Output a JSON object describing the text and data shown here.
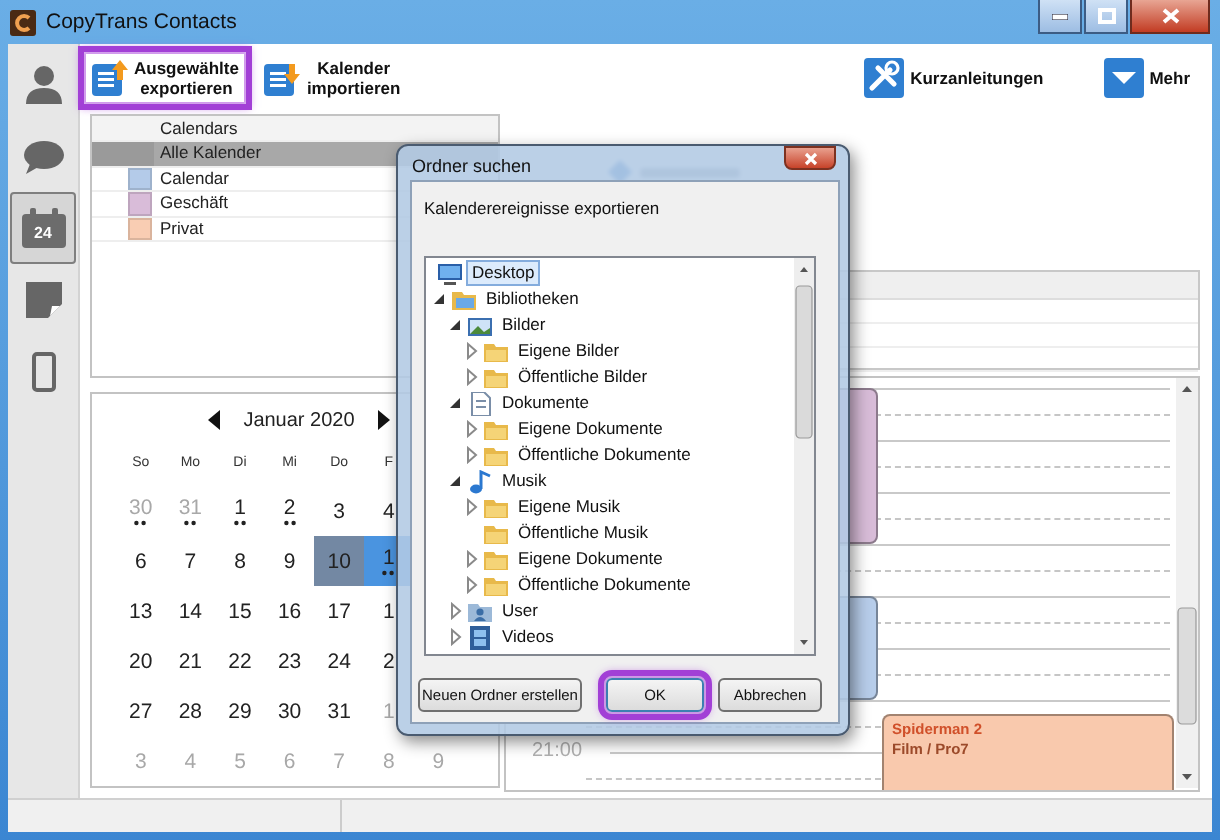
{
  "window": {
    "title": "CopyTrans Contacts"
  },
  "sidebar": {
    "items": [
      {
        "kind": "contacts",
        "selected": false
      },
      {
        "kind": "messages",
        "selected": false
      },
      {
        "kind": "calendar",
        "selected": true,
        "badge": "24"
      },
      {
        "kind": "notes",
        "selected": false
      },
      {
        "kind": "device",
        "selected": false
      }
    ]
  },
  "toolbar": {
    "buttons": [
      {
        "kind": "export",
        "lines": [
          "Ausgewählte",
          "exportieren"
        ],
        "highlighted": true
      },
      {
        "kind": "import",
        "lines": [
          "Kalender",
          "importieren"
        ],
        "highlighted": false
      }
    ],
    "right_buttons": [
      {
        "kind": "guides",
        "label": "Kurzanleitungen"
      },
      {
        "kind": "more",
        "label": "Mehr"
      }
    ]
  },
  "calendars": {
    "header": "Calendars",
    "rows": [
      {
        "name": "Alle Kalender",
        "selected": true
      },
      {
        "name": "Calendar",
        "color": "#b4cbe9",
        "selected": false
      },
      {
        "name": "Geschäft",
        "color": "#d9bcd9",
        "selected": false
      },
      {
        "name": "Privat",
        "color": "#f9cdb3",
        "selected": false
      }
    ]
  },
  "month": {
    "title": "Januar 2020",
    "weekdays": [
      "So",
      "Mo",
      "Di",
      "Mi",
      "Do",
      "F"
    ],
    "weeks": [
      [
        {
          "day": "30",
          "muted": true,
          "events": true,
          "selected": false,
          "today": false
        },
        {
          "day": "31",
          "muted": true,
          "events": true,
          "selected": false,
          "today": false
        },
        {
          "day": "1",
          "muted": false,
          "events": true,
          "selected": false,
          "today": false
        },
        {
          "day": "2",
          "muted": false,
          "events": true,
          "selected": false,
          "today": false
        },
        {
          "day": "3",
          "muted": false,
          "events": false,
          "selected": false,
          "today": false
        },
        {
          "day": "4",
          "muted": false,
          "events": false,
          "selected": false,
          "today": false
        }
      ],
      [
        {
          "day": "6",
          "muted": false,
          "events": false,
          "selected": false,
          "today": false
        },
        {
          "day": "7",
          "muted": false,
          "events": false,
          "selected": false,
          "today": false
        },
        {
          "day": "8",
          "muted": false,
          "events": false,
          "selected": false,
          "today": false
        },
        {
          "day": "9",
          "muted": false,
          "events": false,
          "selected": false,
          "today": false
        },
        {
          "day": "10",
          "muted": false,
          "events": false,
          "selected": true,
          "today": false
        },
        {
          "day": "1",
          "muted": false,
          "events": true,
          "selected": false,
          "today": true
        }
      ],
      [
        {
          "day": "13",
          "muted": false,
          "events": false,
          "selected": false,
          "today": false
        },
        {
          "day": "14",
          "muted": false,
          "events": false,
          "selected": false,
          "today": false
        },
        {
          "day": "15",
          "muted": false,
          "events": false,
          "selected": false,
          "today": false
        },
        {
          "day": "16",
          "muted": false,
          "events": false,
          "selected": false,
          "today": false
        },
        {
          "day": "17",
          "muted": false,
          "events": false,
          "selected": false,
          "today": false
        },
        {
          "day": "1",
          "muted": false,
          "events": false,
          "selected": false,
          "today": false
        }
      ],
      [
        {
          "day": "20",
          "muted": false,
          "events": false,
          "selected": false,
          "today": false
        },
        {
          "day": "21",
          "muted": false,
          "events": false,
          "selected": false,
          "today": false
        },
        {
          "day": "22",
          "muted": false,
          "events": false,
          "selected": false,
          "today": false
        },
        {
          "day": "23",
          "muted": false,
          "events": false,
          "selected": false,
          "today": false
        },
        {
          "day": "24",
          "muted": false,
          "events": false,
          "selected": false,
          "today": false
        },
        {
          "day": "2",
          "muted": false,
          "events": false,
          "selected": false,
          "today": false
        }
      ],
      [
        {
          "day": "27",
          "muted": false,
          "events": false,
          "selected": false,
          "today": false
        },
        {
          "day": "28",
          "muted": false,
          "events": false,
          "selected": false,
          "today": false
        },
        {
          "day": "29",
          "muted": false,
          "events": false,
          "selected": false,
          "today": false
        },
        {
          "day": "30",
          "muted": false,
          "events": false,
          "selected": false,
          "today": false
        },
        {
          "day": "31",
          "muted": false,
          "events": false,
          "selected": false,
          "today": false
        },
        {
          "day": "1",
          "muted": true,
          "events": false,
          "selected": false,
          "today": false
        }
      ],
      [
        {
          "day": "3",
          "muted": true,
          "events": false,
          "selected": false,
          "today": false
        },
        {
          "day": "4",
          "muted": true,
          "events": false,
          "selected": false,
          "today": false
        },
        {
          "day": "5",
          "muted": true,
          "events": false,
          "selected": false,
          "today": false
        },
        {
          "day": "6",
          "muted": true,
          "events": false,
          "selected": false,
          "today": false
        },
        {
          "day": "7",
          "muted": true,
          "events": false,
          "selected": false,
          "today": false
        },
        {
          "day": "8",
          "muted": true,
          "events": false,
          "selected": false,
          "today": false
        },
        {
          "day": "9",
          "muted": true,
          "events": false,
          "selected": false,
          "today": false
        }
      ]
    ]
  },
  "day_view": {
    "time_label": "21:00",
    "events": [
      {
        "color": "#d8bcd8"
      },
      {
        "color": "#b7cdea"
      },
      {
        "color": "#f9c9ad",
        "title": "Spiderman 2",
        "subtitle": "Film / Pro7"
      }
    ]
  },
  "dialog": {
    "title": "Ordner suchen",
    "description": "Kalenderereignisse exportieren",
    "tree": [
      {
        "label": "Desktop",
        "kind": "desktop",
        "selected": true,
        "children": [
          {
            "label": "Bibliotheken",
            "kind": "library",
            "expandable": true,
            "expanded": true,
            "selected": false,
            "children": [
              {
                "label": "Bilder",
                "kind": "pictures",
                "expandable": true,
                "expanded": true,
                "selected": false,
                "children": [
                  {
                    "label": "Eigene Bilder",
                    "kind": "folder",
                    "expandable": true,
                    "expanded": false,
                    "selected": false
                  },
                  {
                    "label": "Öffentliche Bilder",
                    "kind": "folder",
                    "expandable": true,
                    "expanded": false,
                    "selected": false
                  }
                ]
              },
              {
                "label": "Dokumente",
                "kind": "documents",
                "expandable": true,
                "expanded": true,
                "selected": false,
                "children": [
                  {
                    "label": "Eigene Dokumente",
                    "kind": "folder",
                    "expandable": true,
                    "expanded": false,
                    "selected": false
                  },
                  {
                    "label": "Öffentliche Dokumente",
                    "kind": "folder",
                    "expandable": true,
                    "expanded": false,
                    "selected": false
                  }
                ]
              },
              {
                "label": "Musik",
                "kind": "music",
                "expandable": true,
                "expanded": true,
                "selected": false,
                "children": [
                  {
                    "label": "Eigene Musik",
                    "kind": "folder",
                    "expandable": true,
                    "expanded": false,
                    "selected": false
                  },
                  {
                    "label": "Öffentliche Musik",
                    "kind": "folder",
                    "expandable": false,
                    "selected": false
                  },
                  {
                    "label": "Eigene Dokumente",
                    "kind": "folder",
                    "expandable": true,
                    "expanded": false,
                    "selected": false
                  },
                  {
                    "label": "Öffentliche Dokumente",
                    "kind": "folder",
                    "expandable": true,
                    "expanded": false,
                    "selected": false
                  }
                ]
              },
              {
                "label": "User",
                "kind": "user",
                "expandable": true,
                "expanded": false,
                "selected": false
              },
              {
                "label": "Videos",
                "kind": "videos",
                "expandable": true,
                "expanded": false,
                "selected": false
              }
            ]
          }
        ]
      }
    ],
    "buttons": [
      {
        "kind": "new_folder",
        "label": "Neuen Ordner erstellen",
        "default": false,
        "highlighted": false
      },
      {
        "kind": "ok",
        "label": "OK",
        "default": true,
        "highlighted": true
      },
      {
        "kind": "cancel",
        "label": "Abbrechen",
        "default": false,
        "highlighted": false
      }
    ]
  }
}
